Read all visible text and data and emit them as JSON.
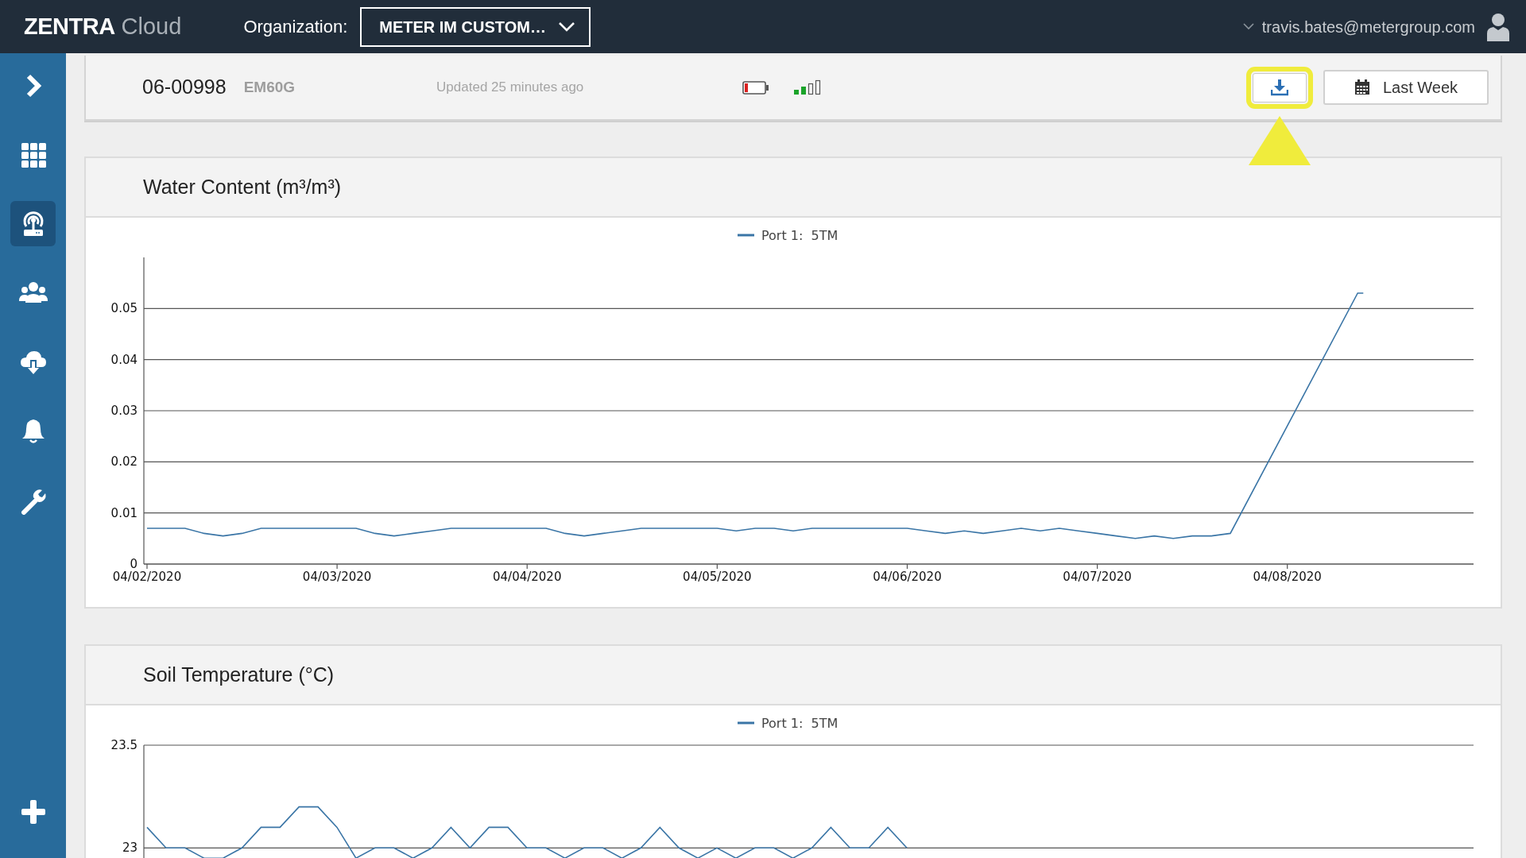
{
  "header": {
    "brand": "ZENTRA",
    "brand_suffix": "Cloud",
    "org_label": "Organization:",
    "org_value": "METER IM CUSTOM…",
    "user_email": "travis.bates@metergroup.com"
  },
  "sidebar": {
    "items": [
      {
        "kind": "expand",
        "selected": false
      },
      {
        "kind": "apps",
        "selected": false
      },
      {
        "kind": "devices",
        "selected": true
      },
      {
        "kind": "users",
        "selected": false
      },
      {
        "kind": "download",
        "selected": false
      },
      {
        "kind": "alerts",
        "selected": false
      },
      {
        "kind": "tools",
        "selected": false
      },
      {
        "kind": "add",
        "selected": false
      }
    ]
  },
  "device": {
    "id": "06-00998",
    "model": "EM60G",
    "updated": "Updated 25 minutes ago",
    "range_button": "Last Week"
  },
  "charts": [
    {
      "title": "Water Content (m³/m³)",
      "chart_data": {
        "type": "line",
        "grid": true,
        "xlim": [
          "2020-04-01T23:36",
          "2020-04-08T23:31"
        ],
        "ylim": [
          0,
          0.06
        ],
        "xticks": [
          {
            "value": "2020-04-02T00:00",
            "label": "04/02/2020"
          },
          {
            "value": "2020-04-03T00:00",
            "label": "04/03/2020"
          },
          {
            "value": "2020-04-04T00:00",
            "label": "04/04/2020"
          },
          {
            "value": "2020-04-05T00:00",
            "label": "04/05/2020"
          },
          {
            "value": "2020-04-06T00:00",
            "label": "04/06/2020"
          },
          {
            "value": "2020-04-07T00:00",
            "label": "04/07/2020"
          },
          {
            "value": "2020-04-08T00:00",
            "label": "04/08/2020"
          }
        ],
        "yticks": [
          0,
          0.01,
          0.02,
          0.03,
          0.04,
          0.05
        ],
        "x": [
          "2020-04-02T00:00",
          "2020-04-02T02:24",
          "2020-04-02T04:48",
          "2020-04-02T07:12",
          "2020-04-02T09:36",
          "2020-04-02T12:00",
          "2020-04-02T14:24",
          "2020-04-02T16:48",
          "2020-04-02T19:12",
          "2020-04-02T21:36",
          "2020-04-03T00:00",
          "2020-04-03T02:24",
          "2020-04-03T04:48",
          "2020-04-03T07:12",
          "2020-04-03T09:36",
          "2020-04-03T12:00",
          "2020-04-03T14:24",
          "2020-04-03T16:48",
          "2020-04-03T19:12",
          "2020-04-03T21:36",
          "2020-04-04T00:00",
          "2020-04-04T02:24",
          "2020-04-04T04:48",
          "2020-04-04T07:12",
          "2020-04-04T09:36",
          "2020-04-04T12:00",
          "2020-04-04T14:24",
          "2020-04-04T16:48",
          "2020-04-04T19:12",
          "2020-04-04T21:36",
          "2020-04-05T00:00",
          "2020-04-05T02:24",
          "2020-04-05T04:48",
          "2020-04-05T07:12",
          "2020-04-05T09:36",
          "2020-04-05T12:00",
          "2020-04-05T14:24",
          "2020-04-05T16:48",
          "2020-04-05T19:12",
          "2020-04-05T21:36",
          "2020-04-06T00:00",
          "2020-04-06T02:24",
          "2020-04-06T04:48",
          "2020-04-06T07:12",
          "2020-04-06T09:36",
          "2020-04-06T12:00",
          "2020-04-06T14:24",
          "2020-04-06T16:48",
          "2020-04-06T19:12",
          "2020-04-06T21:36",
          "2020-04-07T00:00",
          "2020-04-07T02:24",
          "2020-04-07T04:48",
          "2020-04-07T07:12",
          "2020-04-07T09:36",
          "2020-04-07T12:00",
          "2020-04-07T14:24",
          "2020-04-07T16:48",
          "2020-04-08T08:53",
          "2020-04-08T09:36"
        ],
        "series": [
          {
            "name": "Port 1:  5TM",
            "color": "#3a75a6",
            "values": [
              0.007,
              0.007,
              0.007,
              0.006,
              0.0055,
              0.006,
              0.007,
              0.007,
              0.007,
              0.007,
              0.007,
              0.007,
              0.006,
              0.0055,
              0.006,
              0.0065,
              0.007,
              0.007,
              0.007,
              0.007,
              0.007,
              0.007,
              0.006,
              0.0055,
              0.006,
              0.0065,
              0.007,
              0.007,
              0.007,
              0.007,
              0.007,
              0.0065,
              0.007,
              0.007,
              0.0065,
              0.007,
              0.007,
              0.007,
              0.007,
              0.007,
              0.007,
              0.0065,
              0.006,
              0.0065,
              0.006,
              0.0065,
              0.007,
              0.0065,
              0.007,
              0.0065,
              0.006,
              0.0055,
              0.005,
              0.0055,
              0.005,
              0.0055,
              0.0055,
              0.006,
              0.053,
              0.053
            ]
          }
        ]
      }
    },
    {
      "title": "Soil Temperature (°C)",
      "chart_data": {
        "type": "line",
        "grid": true,
        "ylim": [
          22.92,
          23.5
        ],
        "yticks": [
          23,
          23.5
        ],
        "series": [
          {
            "name": "Port 1:  5TM",
            "color": "#3a75a6",
            "values": [
              23.1,
              23.0,
              23.0,
              22.95,
              22.95,
              23.0,
              23.1,
              23.1,
              23.2,
              23.2,
              23.1,
              22.95,
              23.0,
              23.0,
              22.95,
              23.0,
              23.1,
              23.0,
              23.1,
              23.1,
              23.0,
              23.0,
              22.95,
              23.0,
              23.0,
              22.95,
              23.0,
              23.1,
              23.0,
              22.95,
              23.0,
              22.95,
              23.0,
              23.0,
              22.95,
              23.0,
              23.1,
              23.0,
              23.0,
              23.1,
              23.0
            ]
          }
        ]
      }
    }
  ]
}
